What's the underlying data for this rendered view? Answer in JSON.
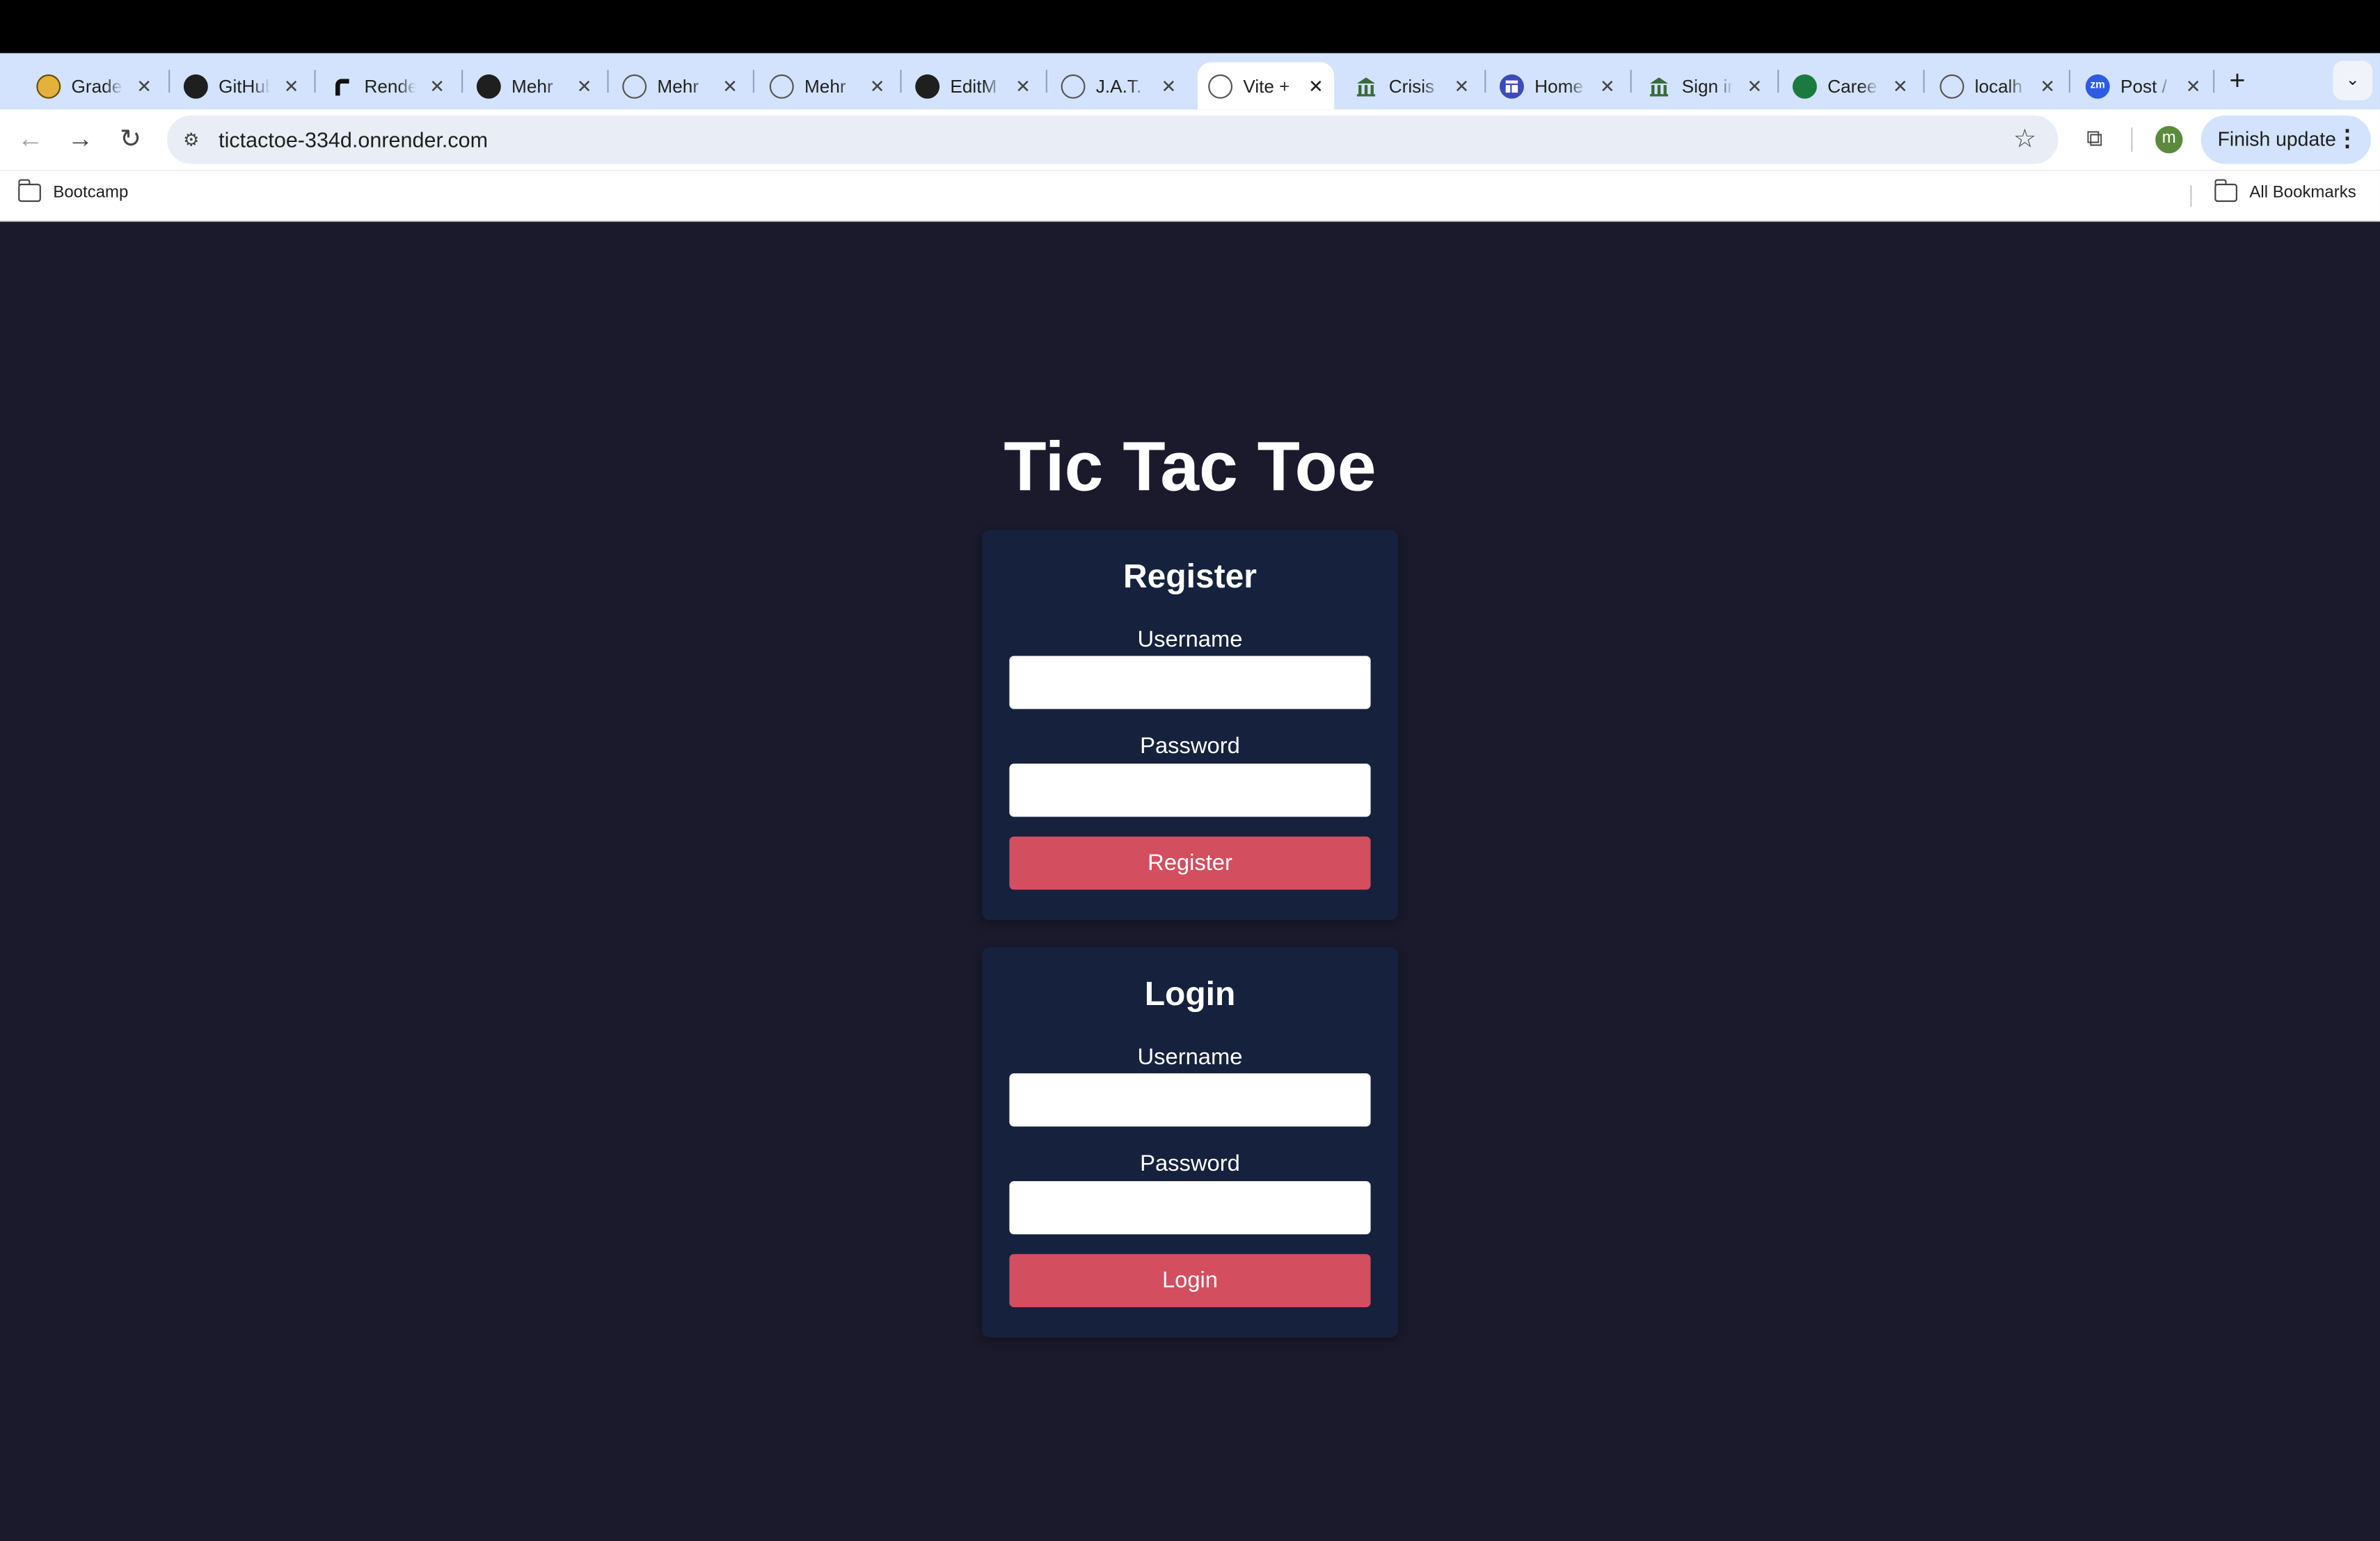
{
  "browser": {
    "tabs": [
      {
        "title": "Grade",
        "icon": "gradescope-icon"
      },
      {
        "title": "GitHub",
        "icon": "github-icon"
      },
      {
        "title": "Render",
        "icon": "render-icon"
      },
      {
        "title": "Mehr",
        "icon": "github-icon"
      },
      {
        "title": "Mehr",
        "icon": "globe-icon"
      },
      {
        "title": "Mehr",
        "icon": "globe-icon"
      },
      {
        "title": "EditM",
        "icon": "edit-icon"
      },
      {
        "title": "J.A.T.",
        "icon": "globe-icon"
      },
      {
        "title": "Vite +",
        "icon": "globe-icon",
        "active": true
      },
      {
        "title": "Crisis",
        "icon": "building-icon"
      },
      {
        "title": "Home",
        "icon": "home-icon"
      },
      {
        "title": "Sign in",
        "icon": "building-icon"
      },
      {
        "title": "Caree",
        "icon": "career-icon"
      },
      {
        "title": "localh",
        "icon": "globe-icon"
      },
      {
        "title": "Post /",
        "icon": "zoom-icon"
      }
    ],
    "tab_close_glyph": "✕",
    "new_tab_glyph": "+",
    "tab_menu_glyph": "⌄",
    "url": "tictactoe-334d.onrender.com",
    "avatar_letter": "m",
    "finish_update_label": "Finish update",
    "bookmarks": {
      "left_folder": "Bootcamp",
      "right_folder": "All Bookmarks"
    }
  },
  "app": {
    "title": "Tic Tac Toe",
    "register": {
      "heading": "Register",
      "username_label": "Username",
      "username_value": "",
      "password_label": "Password",
      "password_value": "",
      "button_label": "Register"
    },
    "login": {
      "heading": "Login",
      "username_label": "Username",
      "username_value": "",
      "password_label": "Password",
      "password_value": "",
      "button_label": "Login"
    }
  },
  "colors": {
    "page_background": "#1b1a2c",
    "card_background": "#16213e",
    "button": "#d34e5f",
    "tabstrip": "#d3e3fd"
  }
}
